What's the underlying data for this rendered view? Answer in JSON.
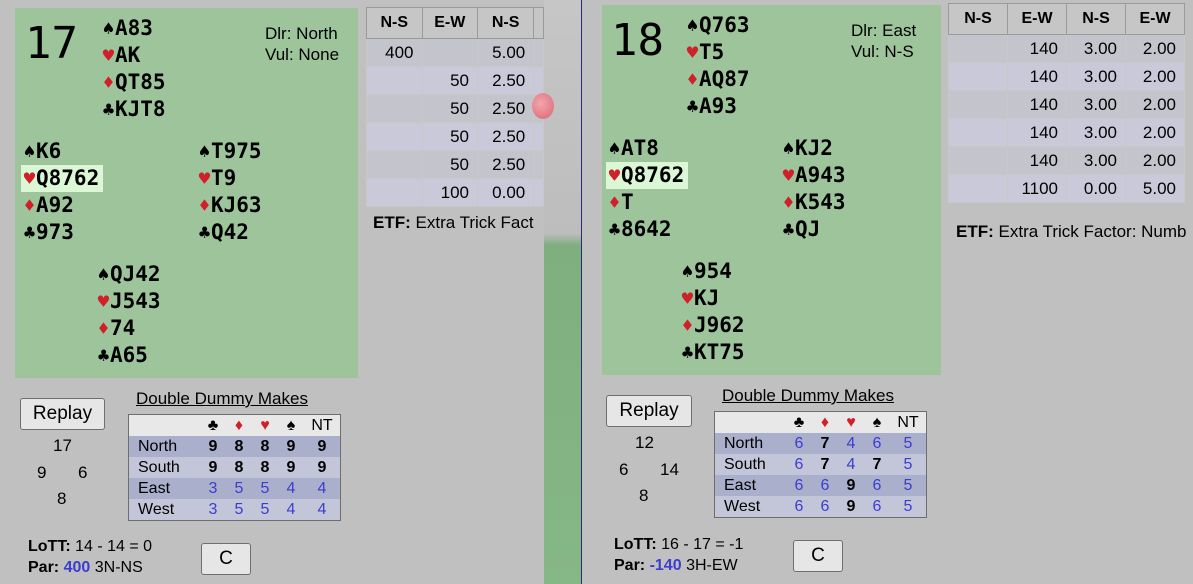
{
  "boards": [
    {
      "number": "17",
      "dealer": "Dlr: North",
      "vul": "Vul: None",
      "north": {
        "spades": "A83",
        "hearts": "AK",
        "diamonds": "QT85",
        "clubs": "KJT8"
      },
      "west": {
        "spades": "K6",
        "hearts": "Q8762",
        "diamonds": "A92",
        "clubs": "973"
      },
      "east": {
        "spades": "T975",
        "hearts": "T9",
        "diamonds": "KJ63",
        "clubs": "Q42"
      },
      "south": {
        "spades": "QJ42",
        "hearts": "J543",
        "diamonds": "74",
        "clubs": "A65"
      },
      "score_headers": [
        "N-S",
        "E-W",
        "N-S"
      ],
      "score_rows": [
        [
          "400",
          "",
          "5.00"
        ],
        [
          "",
          "50",
          "2.50"
        ],
        [
          "",
          "50",
          "2.50"
        ],
        [
          "",
          "50",
          "2.50"
        ],
        [
          "",
          "50",
          "2.50"
        ],
        [
          "",
          "100",
          "0.00"
        ]
      ],
      "etf_label": "ETF:",
      "etf_text": "Extra Trick Fact",
      "replay": "Replay",
      "dd_title": "Double Dummy Makes",
      "dd_cols": [
        "♣",
        "♦",
        "♥",
        "♠",
        "NT"
      ],
      "dd_rows": [
        {
          "player": "North",
          "vals": [
            "9",
            "8",
            "8",
            "9",
            "9"
          ],
          "make": [
            true,
            true,
            true,
            true,
            true
          ]
        },
        {
          "player": "South",
          "vals": [
            "9",
            "8",
            "8",
            "9",
            "9"
          ],
          "make": [
            true,
            true,
            true,
            true,
            true
          ]
        },
        {
          "player": "East",
          "vals": [
            "3",
            "5",
            "5",
            "4",
            "4"
          ],
          "make": [
            false,
            false,
            false,
            false,
            false
          ]
        },
        {
          "player": "West",
          "vals": [
            "3",
            "5",
            "5",
            "4",
            "4"
          ],
          "make": [
            false,
            false,
            false,
            false,
            false
          ]
        }
      ],
      "hcp": {
        "north": "17",
        "west": "9",
        "east": "6",
        "south": "8"
      },
      "lott_label": "LoTT:",
      "lott_text": "14 - 14 = 0",
      "par_label": "Par:",
      "par_value": "400",
      "par_contract": "3N-NS",
      "c_button": "C"
    },
    {
      "number": "18",
      "dealer": "Dlr: East",
      "vul": "Vul: N-S",
      "north": {
        "spades": "Q763",
        "hearts": "T5",
        "diamonds": "AQ87",
        "clubs": "A93"
      },
      "west": {
        "spades": "AT8",
        "hearts": "Q8762",
        "diamonds": "T",
        "clubs": "8642"
      },
      "east": {
        "spades": "KJ2",
        "hearts": "A943",
        "diamonds": "K543",
        "clubs": "QJ"
      },
      "south": {
        "spades": "954",
        "hearts": "KJ",
        "diamonds": "J962",
        "clubs": "KT75"
      },
      "score_headers": [
        "N-S",
        "E-W",
        "N-S",
        "E-W"
      ],
      "score_rows": [
        [
          "",
          "140",
          "3.00",
          "2.00"
        ],
        [
          "",
          "140",
          "3.00",
          "2.00"
        ],
        [
          "",
          "140",
          "3.00",
          "2.00"
        ],
        [
          "",
          "140",
          "3.00",
          "2.00"
        ],
        [
          "",
          "140",
          "3.00",
          "2.00"
        ],
        [
          "",
          "1100",
          "0.00",
          "5.00"
        ]
      ],
      "etf_label": "ETF:",
      "etf_text": "Extra Trick Factor: Numb",
      "replay": "Replay",
      "dd_title": "Double Dummy Makes",
      "dd_cols": [
        "♣",
        "♦",
        "♥",
        "♠",
        "NT"
      ],
      "dd_rows": [
        {
          "player": "North",
          "vals": [
            "6",
            "7",
            "4",
            "6",
            "5"
          ],
          "make": [
            false,
            true,
            false,
            false,
            false
          ]
        },
        {
          "player": "South",
          "vals": [
            "6",
            "7",
            "4",
            "7",
            "5"
          ],
          "make": [
            false,
            true,
            false,
            true,
            false
          ]
        },
        {
          "player": "East",
          "vals": [
            "6",
            "6",
            "9",
            "6",
            "5"
          ],
          "make": [
            false,
            false,
            true,
            false,
            false
          ]
        },
        {
          "player": "West",
          "vals": [
            "6",
            "6",
            "9",
            "6",
            "5"
          ],
          "make": [
            false,
            false,
            true,
            false,
            false
          ]
        }
      ],
      "hcp": {
        "north": "12",
        "west": "6",
        "east": "14",
        "south": "8"
      },
      "lott_label": "LoTT:",
      "lott_text": "16 - 17 = -1",
      "par_label": "Par:",
      "par_value": "-140",
      "par_contract": "3H-EW",
      "c_button": "C"
    }
  ],
  "symbols": {
    "spade": "♠",
    "heart": "♥",
    "diamond": "♦",
    "club": "♣"
  },
  "colors": {
    "card_panel": "#9dc49b",
    "page_bg": "#c0c0c0",
    "red_suit": "#d0202a",
    "par_blue": "#3c3ccf"
  }
}
